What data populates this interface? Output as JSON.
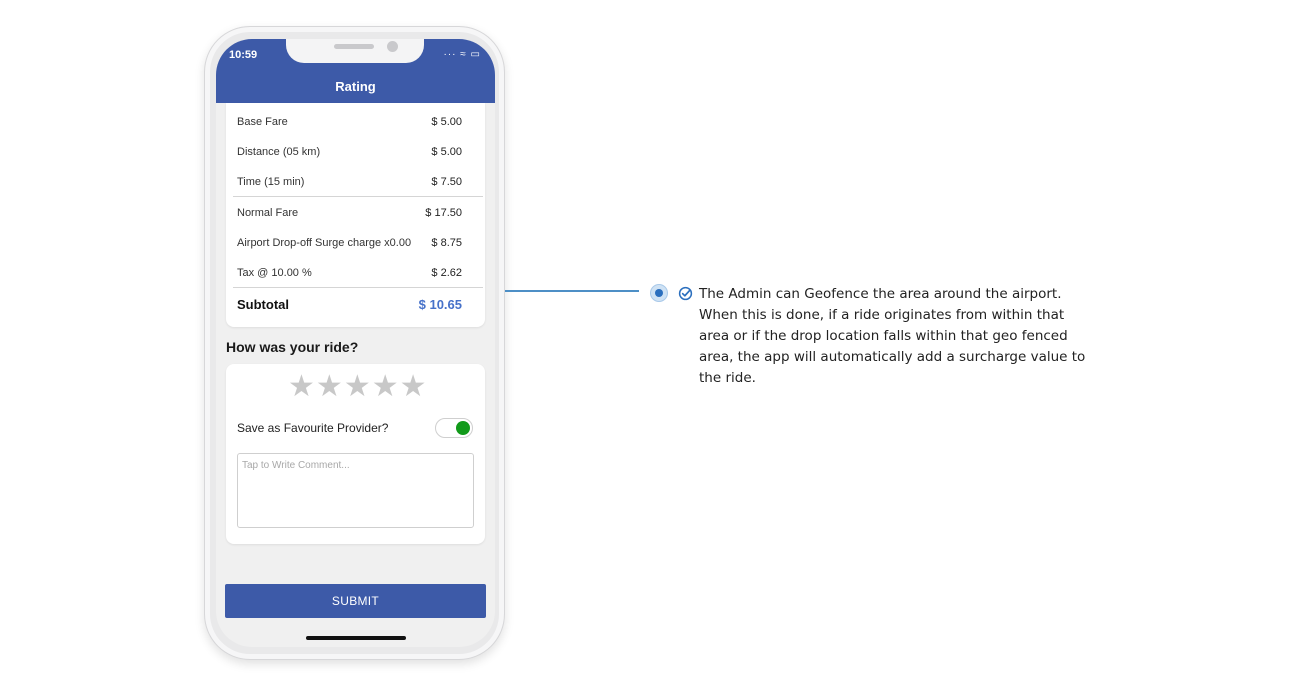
{
  "status_bar": {
    "time": "10:59",
    "icons": "···  ≈  ▭"
  },
  "app_bar": {
    "title": "Rating"
  },
  "fare": {
    "rows": [
      {
        "label": "Base Fare",
        "value": "$ 5.00"
      },
      {
        "label": "Distance (05 km)",
        "value": "$ 5.00"
      },
      {
        "label": "Time (15 min)",
        "value": "$ 7.50"
      },
      {
        "label": "Normal Fare",
        "value": "$ 17.50"
      },
      {
        "label": "Airport Drop-off Surge charge x0.00",
        "value": "$ 8.75"
      },
      {
        "label": "Tax @ 10.00 %",
        "value": "$ 2.62"
      }
    ],
    "subtotal_label": "Subtotal",
    "subtotal_value": "$ 10.65"
  },
  "rating": {
    "question": "How was your ride?",
    "stars_total": 5,
    "stars_selected": 0,
    "favourite_label": "Save as Favourite Provider?",
    "favourite_on": true,
    "comment_placeholder": "Tap to Write Comment..."
  },
  "submit_label": "SUBMIT",
  "callout": {
    "lines": [
      "The Admin can Geofence the area around the airport.",
      "When this is done, if a ride originates from within that",
      "area or if the drop location falls within that geo fenced",
      "area, the app will automatically add a surcharge value to",
      "the ride."
    ]
  },
  "colors": {
    "primary": "#3d5aa8",
    "accent": "#4671c9",
    "toggle_on": "#119a1a",
    "connector": "#4d8fc6"
  }
}
